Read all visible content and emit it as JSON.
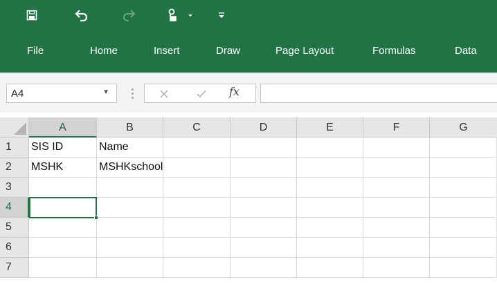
{
  "quick_access": {
    "items": [
      {
        "name": "save-icon"
      },
      {
        "name": "undo-icon"
      },
      {
        "name": "redo-icon"
      },
      {
        "name": "touch-mode-icon"
      },
      {
        "name": "customize-qat-icon"
      }
    ]
  },
  "ribbon": {
    "background": "#217346",
    "tabs": [
      "File",
      "Home",
      "Insert",
      "Draw",
      "Page Layout",
      "Formulas",
      "Data"
    ]
  },
  "formula_bar": {
    "name_box": "A4",
    "function_label": "fx",
    "formula_value": ""
  },
  "sheet": {
    "columns": [
      "A",
      "B",
      "C",
      "D",
      "E",
      "F",
      "G"
    ],
    "rows": [
      "1",
      "2",
      "3",
      "4",
      "5",
      "6",
      "7"
    ],
    "cells": {
      "A1": "SIS ID",
      "B1": "Name",
      "A2": "MSHK",
      "B2": "MSHKschool"
    },
    "selected_cell": "A4",
    "accent": "#217346"
  }
}
